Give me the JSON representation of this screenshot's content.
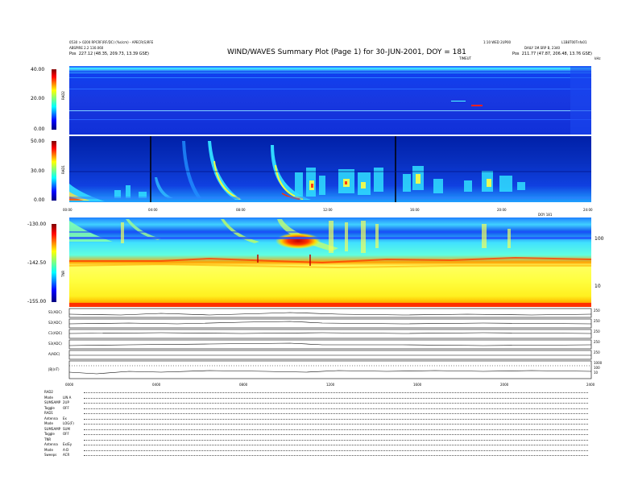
{
  "header": {
    "title": "WIND/WAVES Summary Plot (Page 1) for 30-JUN-2001, DOY = 181",
    "left_line1": "0530 > 0200 RPCRF(RF/DC) (%s/cm) - APECR(S)RFE",
    "left_line2": "ABSPIRE 2.2 130.060",
    "left_line3_label": "Pos",
    "left_line3_value": "227.12 (48.35, 209.73, 13.39 GSE)",
    "right_line1": "1:10 WED 2UP00",
    "right_line2": "L1B8T00Tnfo01",
    "right_line3": "DAILY 1M.SRP B, 2340",
    "right_line4_label": "Pos",
    "right_line4_value": "211.77 (47.87, 206.48, 13.76 GSE)",
    "time_label_top": "TIMEUT",
    "units_top": "kHz"
  },
  "colorbar": {
    "rad2_ticks": [
      "40.00",
      "20.00",
      "0.00"
    ],
    "rad2_label": "RAD2",
    "rad1_ticks": [
      "50.00",
      "30.00",
      "0.00"
    ],
    "rad1_label": "RAD1",
    "tnr_ticks": [
      "-130.00",
      "-142.50",
      "-155.00"
    ],
    "tnr_label": "TNR"
  },
  "axes": {
    "mid_time_ticks": [
      "00:00",
      "04:00",
      "08:00",
      "12:00",
      "16:00",
      "20:00",
      "24:00"
    ],
    "mid_time_label": "DOY 181",
    "tnr_right_ticks": [
      "100",
      "10"
    ],
    "bottom_time_ticks": [
      "0000",
      "0400",
      "0800",
      "1200",
      "1600",
      "2000",
      "2400"
    ]
  },
  "chart_data": {
    "type": "heatmap",
    "title": "WIND/WAVES Summary Plot (Page 1) for 30-JUN-2001, DOY = 181",
    "xlabel": "",
    "xlim_hours": [
      0,
      24
    ],
    "colorscale": [
      "#000080",
      "#0000ff",
      "#00ffff",
      "#ffff00",
      "#ff0000",
      "#800000"
    ],
    "panels": [
      {
        "name": "RAD2",
        "colorbar_ticks": [
          40.0,
          20.0,
          0.0
        ],
        "background": "#1030e8"
      },
      {
        "name": "RAD1",
        "colorbar_ticks": [
          50.0,
          30.0,
          0.0
        ],
        "background": "#1040e0",
        "type_iii_bursts_hours": [
          2.2,
          3.7,
          5.9,
          6.3,
          7.2,
          8.4,
          10.6,
          11.0,
          11.7,
          12.3,
          13.2,
          14.7,
          15.6,
          16.3,
          17.0,
          18.2,
          19.6,
          20.5,
          21.0,
          21.7
        ]
      },
      {
        "name": "TNR",
        "colorbar_ticks": [
          -130.0,
          -142.5,
          -155.0
        ],
        "right_ticks": [
          "100",
          "10"
        ],
        "intense_event_hours": [
          9.7,
          10.9
        ]
      }
    ],
    "timeseries": [
      {
        "name": "S1(ADC)",
        "right_ticks": [
          "250",
          "0"
        ]
      },
      {
        "name": "S2(ADC)",
        "right_ticks": [
          "250",
          "0"
        ]
      },
      {
        "name": "C1(ADC)",
        "right_ticks": [
          "250",
          "0"
        ]
      },
      {
        "name": "S3(ADC)",
        "right_ticks": [
          "250",
          "0"
        ]
      },
      {
        "name": "A(ADC)",
        "right_ticks": [
          "250",
          "0"
        ]
      },
      {
        "name": "|B|(nT)",
        "right_ticks": [
          "1000",
          "100",
          "10",
          "0"
        ]
      }
    ]
  },
  "footer": {
    "rows": [
      {
        "label": "RAD2",
        "value": ""
      },
      {
        "label": "Mode",
        "value": "LIN A"
      },
      {
        "label": "SUMSAMP",
        "value": "2UP"
      },
      {
        "label": "Toggle",
        "value": "OFF"
      },
      {
        "label": "RAD1",
        "value": ""
      },
      {
        "label": "Antenna",
        "value": "Ex"
      },
      {
        "label": "Mode",
        "value": "LOG(F)"
      },
      {
        "label": "SUMSAMP",
        "value": "SUM"
      },
      {
        "label": "Toggle",
        "value": "OFF"
      },
      {
        "label": "TNR",
        "value": ""
      },
      {
        "label": "Antenna",
        "value": "Ex/Ey"
      },
      {
        "label": "Mode",
        "value": "A-D"
      },
      {
        "label": "Sweeps",
        "value": "ACR"
      }
    ]
  },
  "colors": {
    "jet_dark_blue": "#0000a0",
    "jet_blue": "#1040ff",
    "jet_cyan": "#00e8ff",
    "jet_yellow": "#ffff40",
    "jet_red": "#ff2000"
  }
}
